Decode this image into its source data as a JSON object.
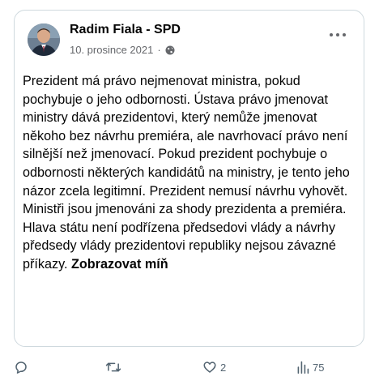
{
  "post": {
    "author": "Radim Fiala - SPD",
    "date": "10. prosince 2021",
    "separator": "·",
    "text": "Prezident má právo nejmenovat ministra, pokud pochybuje o jeho odbornosti. Ústava právo jmenovat ministry dává prezidentovi, který nemůže jmenovat někoho bez návrhu premiéra, ale navrhovací právo není silnější než jmenovací. Pokud prezident pochybuje o odbornosti některých kandidátů na ministry, je tento jeho názor zcela legitimní. Prezident nemusí návrhu vyhovět. Ministři jsou jmenováni za shody prezidenta a premiéra. Hlava státu není podřízena předsedovi vlády a návrhy předsedy vlády prezidentovi republiky nejsou závazné příkazy.",
    "see_more": "Zobrazovat míň"
  },
  "actions": {
    "reply": {
      "icon": "reply-icon",
      "count": ""
    },
    "repost": {
      "icon": "repost-icon",
      "count": ""
    },
    "like": {
      "icon": "heart-icon",
      "count": "2"
    },
    "views": {
      "icon": "views-icon",
      "count": "75"
    }
  },
  "icons": {
    "privacy": "globe-icon",
    "menu": "more-options-icon"
  },
  "colors": {
    "text": "#050505",
    "muted": "#65676b",
    "action": "#536471",
    "border": "#cfd9de"
  }
}
